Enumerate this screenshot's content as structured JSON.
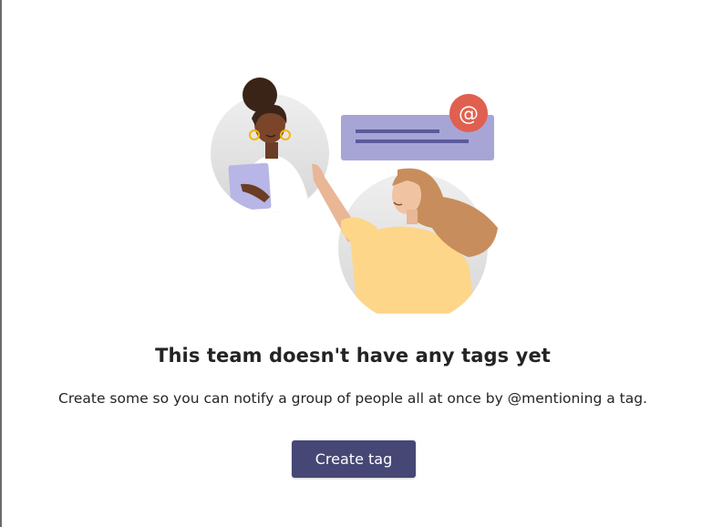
{
  "empty_state": {
    "title": "This team doesn't have any tags yet",
    "description": "Create some so you can notify a group of people all at once by @mentioning a tag.",
    "create_button_label": "Create tag"
  },
  "illustration": {
    "mention_symbol": "@"
  },
  "colors": {
    "primary_button": "#464775",
    "mention_badge": "#e0604f",
    "message_card": "#a7a5d6"
  }
}
